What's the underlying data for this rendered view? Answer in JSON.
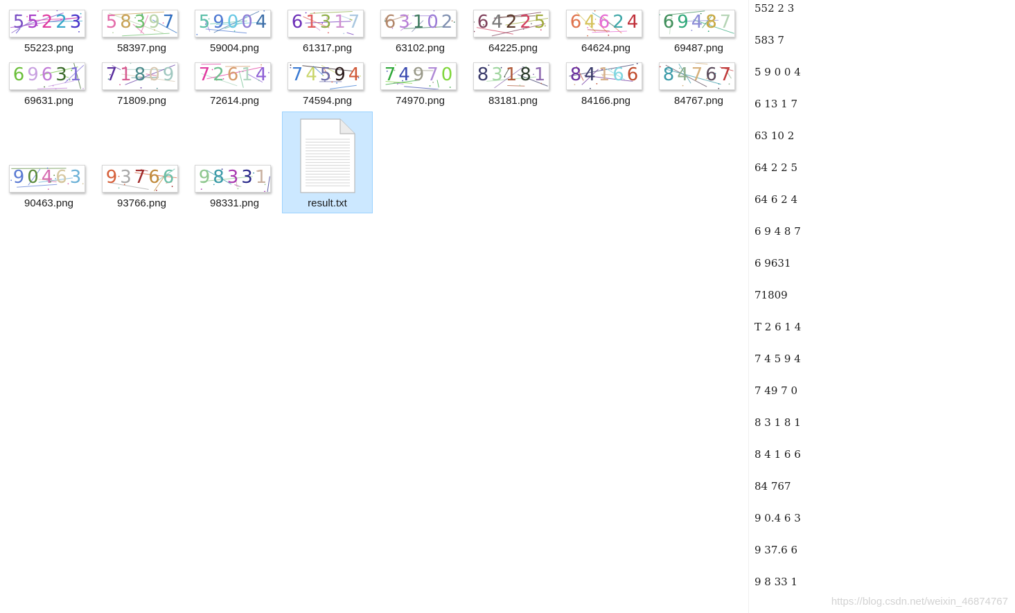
{
  "files": [
    {
      "name": "55223.png",
      "digits": [
        "5",
        "5",
        "2",
        "2",
        "3"
      ],
      "colors": [
        "#7b4fc4",
        "#a83cc8",
        "#e03aa0",
        "#33a6c8",
        "#4531c9"
      ]
    },
    {
      "name": "58397.png",
      "digits": [
        "5",
        "8",
        "3",
        "9",
        "7"
      ],
      "colors": [
        "#e36aa8",
        "#c8a256",
        "#6bbf6b",
        "#b8d4a8",
        "#2f6fc0"
      ]
    },
    {
      "name": "59004.png",
      "digits": [
        "5",
        "9",
        "0",
        "0",
        "4"
      ],
      "colors": [
        "#5bbfa8",
        "#4f7ad3",
        "#67c7e4",
        "#8e7bd6",
        "#3c6ea8"
      ]
    },
    {
      "name": "61317.png",
      "digits": [
        "6",
        "1",
        "3",
        "1",
        "7"
      ],
      "colors": [
        "#6c2fb8",
        "#e05a5a",
        "#8fae47",
        "#cf8fd0",
        "#a9c7e0"
      ]
    },
    {
      "name": "63102.png",
      "digits": [
        "6",
        "3",
        "1",
        "0",
        "2"
      ],
      "colors": [
        "#b2876a",
        "#b77fd6",
        "#3e7a5f",
        "#9a7ad6",
        "#7f8fb0"
      ]
    },
    {
      "name": "64225.png",
      "digits": [
        "6",
        "4",
        "2",
        "2",
        "5"
      ],
      "colors": [
        "#7e3f5a",
        "#777777",
        "#5a3a2a",
        "#d2405f",
        "#a0a93a"
      ]
    },
    {
      "name": "64624.png",
      "digits": [
        "6",
        "4",
        "6",
        "2",
        "4"
      ],
      "colors": [
        "#e0734c",
        "#d6c25a",
        "#e66bd4",
        "#3fa7a7",
        "#c0303a"
      ]
    },
    {
      "name": "69487.png",
      "digits": [
        "6",
        "9",
        "4",
        "8",
        "7"
      ],
      "colors": [
        "#3e8e5a",
        "#2fa87a",
        "#8b8bd6",
        "#c7a73f",
        "#b5d4b5"
      ]
    },
    {
      "name": "69631.png",
      "digits": [
        "6",
        "9",
        "6",
        "3",
        "1"
      ],
      "colors": [
        "#6bbf3a",
        "#c8a0e0",
        "#c07ad6",
        "#3a6a2a",
        "#7f6fd6"
      ]
    },
    {
      "name": "71809.png",
      "digits": [
        "7",
        "1",
        "8",
        "0",
        "9"
      ],
      "colors": [
        "#5a2f9e",
        "#d65a8f",
        "#4a8a8a",
        "#d6c7b0",
        "#a0c8c0"
      ]
    },
    {
      "name": "72614.png",
      "digits": [
        "7",
        "2",
        "6",
        "1",
        "4"
      ],
      "colors": [
        "#e03aa0",
        "#6fbf8f",
        "#d69a6a",
        "#b0d6c0",
        "#8e5fd6"
      ]
    },
    {
      "name": "74594.png",
      "digits": [
        "7",
        "4",
        "5",
        "9",
        "4"
      ],
      "colors": [
        "#3a7ad3",
        "#c9d66a",
        "#6a6aa8",
        "#2a1a1a",
        "#d05a3a"
      ]
    },
    {
      "name": "74970.png",
      "digits": [
        "7",
        "4",
        "9",
        "7",
        "0"
      ],
      "colors": [
        "#2fa83a",
        "#3a4ab0",
        "#9a9a8a",
        "#b08ad6",
        "#7fd63a"
      ]
    },
    {
      "name": "83181.png",
      "digits": [
        "8",
        "3",
        "1",
        "8",
        "1"
      ],
      "colors": [
        "#3a3a6a",
        "#a0d6a0",
        "#b05a3a",
        "#2a3a2a",
        "#8e6ab0"
      ]
    },
    {
      "name": "84166.png",
      "digits": [
        "8",
        "4",
        "1",
        "6",
        "6"
      ],
      "colors": [
        "#6a2f9e",
        "#3a3a6a",
        "#d6b08a",
        "#7fd6e0",
        "#c04a2a"
      ]
    },
    {
      "name": "84767.png",
      "digits": [
        "8",
        "4",
        "7",
        "6",
        "7"
      ],
      "colors": [
        "#3a9aa8",
        "#8fb08f",
        "#d6b07a",
        "#5a4a5a",
        "#c03a3a"
      ]
    },
    {
      "name": "90463.png",
      "digits": [
        "9",
        "0",
        "4",
        "6",
        "3"
      ],
      "colors": [
        "#5a7ad3",
        "#5a8a3a",
        "#d66ab0",
        "#d6c7a0",
        "#6ab0d6"
      ]
    },
    {
      "name": "93766.png",
      "digits": [
        "9",
        "3",
        "7",
        "6",
        "6"
      ],
      "colors": [
        "#d6603a",
        "#a8a8a8",
        "#a02a2a",
        "#c08a3a",
        "#6abfa8"
      ]
    },
    {
      "name": "98331.png",
      "digits": [
        "9",
        "8",
        "3",
        "3",
        "1"
      ],
      "colors": [
        "#8fc78f",
        "#3a9aa8",
        "#a83ab0",
        "#2a2a8a",
        "#c8b0a0"
      ]
    }
  ],
  "result_file": {
    "name": "result.txt",
    "icon": "text-document-icon",
    "selected": true
  },
  "result_lines": [
    "552 2 3",
    "583 7",
    "5 9 0 0 4",
    "6 13 1 7",
    "63 10 2",
    "64 2 2 5",
    "64 6 2 4",
    "6 9 4 8 7",
    "6 9631",
    "71809",
    "T 2 6 1 4",
    "7 4 5 9 4",
    "7 49 7 0",
    "8 3 1 8 1",
    "8 4 1 6 6",
    "84 767",
    "9 0.4 6 3",
    "9 37.6 6",
    "9 8 33 1"
  ],
  "watermark": "https://blog.csdn.net/weixin_46874767",
  "colors": {
    "selection": "#cce8ff",
    "selection_border": "#99d1ff"
  }
}
